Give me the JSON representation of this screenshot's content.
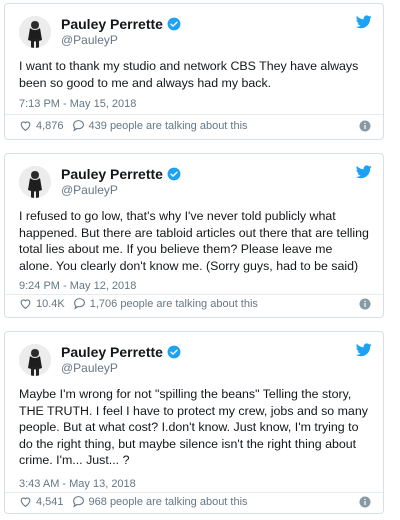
{
  "tweets": [
    {
      "name": "Pauley Perrette",
      "handle": "@PauleyP",
      "text": "I want to thank my studio and network CBS They have always been so good to me and always had my back.",
      "time": "7:13 PM - May 15, 2018",
      "likes": "4,876",
      "talking": "439 people are talking about this"
    },
    {
      "name": "Pauley Perrette",
      "handle": "@PauleyP",
      "text": "I refused to go low, that's why I've never told publicly what happened. But there are tabloid articles out there that are telling total lies about me. If you believe them? Please leave me alone. You clearly don't know me. (Sorry guys, had to be said)",
      "time": "9:24 PM - May 12, 2018",
      "likes": "10.4K",
      "talking": "1,706 people are talking about this"
    },
    {
      "name": "Pauley Perrette",
      "handle": "@PauleyP",
      "text": "Maybe I'm wrong for not \"spilling the beans\" Telling the story, THE TRUTH. I feel I have to protect my crew, jobs and so many people. But at what cost? I.don't know. Just know, I'm trying to do the right thing, but maybe silence isn't the right thing about crime. I'm... Just... ?",
      "time": "3:43 AM - May 13, 2018",
      "likes": "4,541",
      "talking": "968 people are talking about this"
    }
  ],
  "colors": {
    "twitter_blue": "#1da1f2",
    "text": "#14171a",
    "muted": "#657786",
    "border": "#d8dfe5"
  },
  "icons": {
    "brand": "twitter-bird-icon",
    "verified": "verified-badge-icon",
    "like": "heart-icon",
    "reply": "speech-bubble-icon",
    "info": "info-icon"
  }
}
